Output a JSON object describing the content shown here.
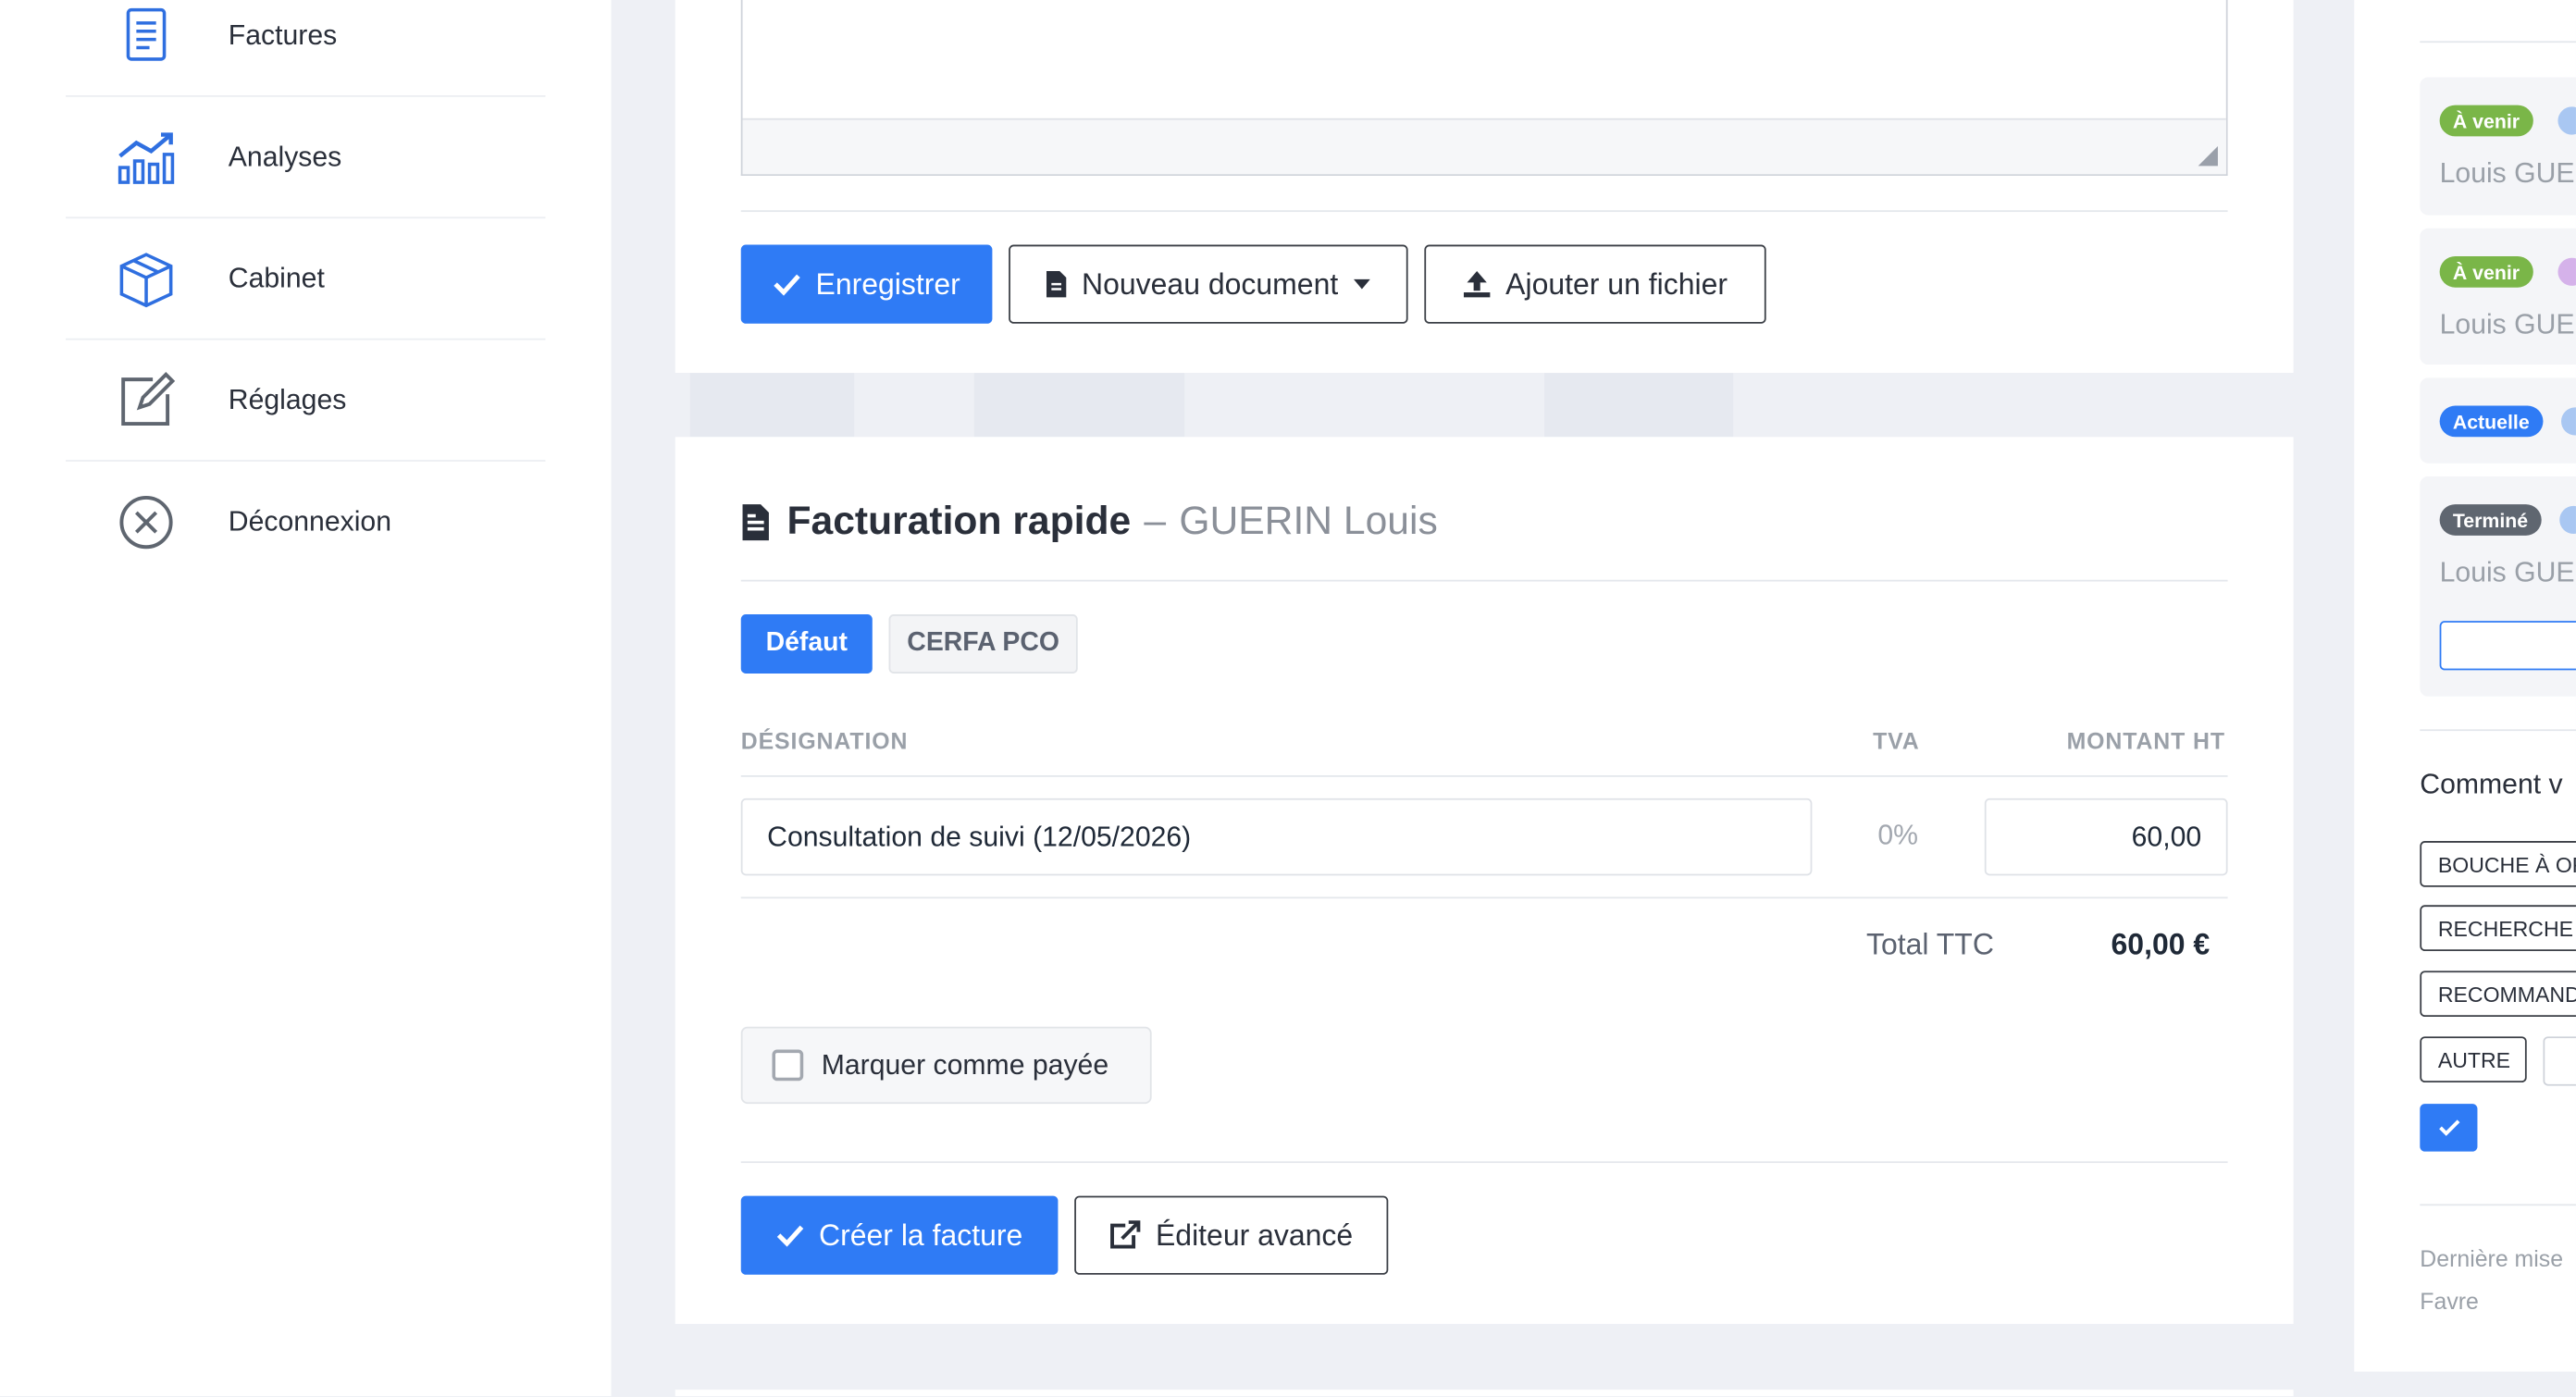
{
  "sidebar": {
    "items": [
      {
        "label": "Factures",
        "icon": "invoice-icon"
      },
      {
        "label": "Analyses",
        "icon": "chart-icon"
      },
      {
        "label": "Cabinet",
        "icon": "box-icon"
      },
      {
        "label": "Réglages",
        "icon": "edit-icon"
      },
      {
        "label": "Déconnexion",
        "icon": "close-circle-icon"
      }
    ]
  },
  "notes": {
    "save_label": "Enregistrer",
    "new_document_label": "Nouveau document",
    "add_file_label": "Ajouter un fichier"
  },
  "billing": {
    "title": "Facturation rapide",
    "separator": "–",
    "patient": "GUERIN Louis",
    "tabs": [
      "Défaut",
      "CERFA PCO"
    ],
    "columns": {
      "designation": "DÉSIGNATION",
      "tva": "TVA",
      "amount": "MONTANT HT"
    },
    "line": {
      "designation": "Consultation de suivi (12/05/2026)",
      "tva": "0%",
      "amount": "60,00"
    },
    "total_label": "Total TTC",
    "total_value": "60,00 €",
    "paid_label": "Marquer comme payée",
    "create_label": "Créer la facture",
    "advanced_label": "Éditeur avancé"
  },
  "right_panel": {
    "appointments": [
      {
        "status": "À venir",
        "status_color": "#7ab648",
        "dot_color": "#a9c7f2",
        "name": "Louis GUE"
      },
      {
        "status": "À venir",
        "status_color": "#7ab648",
        "dot_color": "#d5b2ea",
        "name": "Louis GUE"
      },
      {
        "status": "Actuelle",
        "status_color": "#2f7bf5",
        "dot_color": "#a9c7f2",
        "name": ""
      },
      {
        "status": "Terminé",
        "status_color": "#5f6670",
        "dot_color": "#a9c7f2",
        "name": "Louis GUE"
      }
    ],
    "section_title": "Comment v",
    "tags": [
      "BOUCHE À OR",
      "RECHERCHE I",
      "RECOMMAND",
      "AUTRE"
    ],
    "last_update": "Dernière mise",
    "last_update_by": "Favre"
  },
  "colors": {
    "primary": "#2f7bf5",
    "success": "#7ab648",
    "muted": "#9aa0a8"
  }
}
